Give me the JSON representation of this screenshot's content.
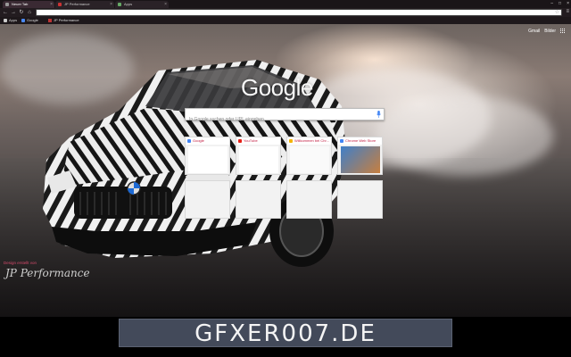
{
  "browser": {
    "tabs": [
      {
        "label": "Neuer Tab",
        "active": true
      },
      {
        "label": "JP Performance",
        "active": false
      },
      {
        "label": "Apps",
        "active": false
      }
    ],
    "address_value": "",
    "bookmarks": [
      {
        "label": "Apps"
      },
      {
        "label": "Google"
      },
      {
        "label": "JP Performance"
      }
    ]
  },
  "newtab": {
    "top_links": [
      "Gmail",
      "Bilder"
    ],
    "logo_text": "Google",
    "search_placeholder": "In Google suchen oder URL eingeben",
    "tiles": [
      {
        "title": "Google",
        "icon_color": "#4285f4"
      },
      {
        "title": "YouTube",
        "icon_color": "#e62117"
      },
      {
        "title": "Willkommen bei Chr...",
        "icon_color": "#f4b400"
      },
      {
        "title": "Chrome Web Store",
        "icon_color": "#4285f4"
      },
      {
        "title": "",
        "icon_color": ""
      },
      {
        "title": "",
        "icon_color": ""
      },
      {
        "title": "",
        "icon_color": ""
      },
      {
        "title": "",
        "icon_color": ""
      }
    ],
    "credit_text": "Design erstellt von",
    "signature_text": "JP Performance"
  },
  "watermark": {
    "text": "GFXER007.DE"
  },
  "colors": {
    "accent": "#c21a3f",
    "chrome_dark": "#231c20",
    "banner_box": "#434a5a"
  }
}
